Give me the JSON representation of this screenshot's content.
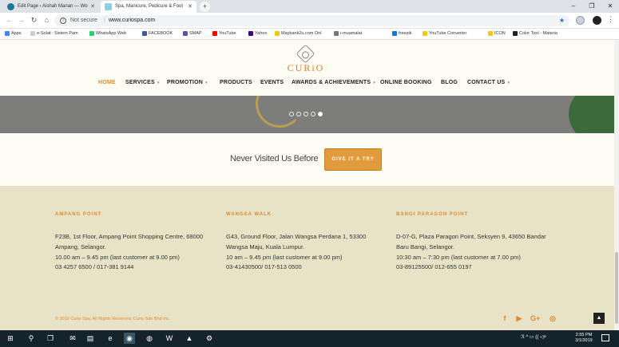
{
  "browser": {
    "tabs": [
      {
        "title": "Edit Page ‹ Aishah Manan — Wo",
        "close": "✕"
      },
      {
        "title": "Spa, Manicure, Pedicure & Foot",
        "close": "✕"
      }
    ],
    "new_tab": "+",
    "window_controls": {
      "minimize": "–",
      "maximize": "❐",
      "close": "✕"
    },
    "nav": {
      "back": "←",
      "forward": "→",
      "reload": "↻",
      "home": "⌂"
    },
    "address": {
      "security_label": "Not secure",
      "url": "www.curiospa.com",
      "star": "★"
    },
    "menu": "⋮",
    "bookmarks": [
      {
        "label": "Apps",
        "color": "#4285f4"
      },
      {
        "label": "e-Solat : Sistem Pam",
        "color": "#cccccc"
      },
      {
        "label": "WhatsApp Web",
        "color": "#25d366"
      },
      {
        "label": "FACEBOOK",
        "color": "#3b5998"
      },
      {
        "label": "SMAP",
        "color": "#6a4ea1"
      },
      {
        "label": "YouTube",
        "color": "#ff0000"
      },
      {
        "label": "Yahoo",
        "color": "#400090"
      },
      {
        "label": "Maybank2u.com Onl",
        "color": "#f5c518"
      },
      {
        "label": "i-muamalat",
        "color": "#777777"
      },
      {
        "label": "freepik",
        "color": "#1273eb"
      },
      {
        "label": "YouTube Converter",
        "color": "#f5c518"
      },
      {
        "label": "ICON",
        "color": "#f5c518"
      },
      {
        "label": "Color Tool - Materia",
        "color": "#222222"
      }
    ]
  },
  "site": {
    "logo": "CURiO",
    "nav": [
      {
        "label": "HOME",
        "caret": false,
        "active": true
      },
      {
        "label": "SERVICES",
        "caret": true,
        "active": false
      },
      {
        "label": "PROMOTION",
        "caret": true,
        "active": false
      },
      {
        "label": "PRODUCTS",
        "caret": false,
        "active": false
      },
      {
        "label": "EVENTS",
        "caret": false,
        "active": false
      },
      {
        "label": "AWARDS & ACHIEVEMENTS",
        "caret": true,
        "active": false
      },
      {
        "label": "ONLINE BOOKING",
        "caret": false,
        "active": false
      },
      {
        "label": "BLOG",
        "caret": false,
        "active": false
      },
      {
        "label": "CONTACT US",
        "caret": true,
        "active": false
      }
    ],
    "slider": {
      "dot_count": 5,
      "active_index": 4
    },
    "cta": {
      "text": "Never Visited Us Before",
      "button": "GIVE IT A TRY"
    },
    "locations": [
      {
        "name": "AMPANG POINT",
        "lines": [
          "F23B, 1st Floor, Ampang Point Shopping Centre, 68000",
          "Ampang, Selangor.",
          "10.00 am – 9.45 pm (last customer at 9.00 pm)",
          "03 4257 6500 / 017-381 9144"
        ]
      },
      {
        "name": "WANGSA WALK",
        "lines": [
          "G43, Ground Floor, Jalan Wangsa Perdana 1, 53300",
          "Wangsa Maju, Kuala Lumpur.",
          "10 am – 9.45 pm (last customer at 9.00 pm)",
          "03-41430500/ 017-513 0500"
        ]
      },
      {
        "name": "BANGI PARAGON POINT",
        "lines": [
          "D-07-G, Plaza Paragon Point, Seksyen 9, 43650 Bandar",
          "Baru Bangi, Selangor.",
          "10:30 am – 7:30 pm (last customer at 7.00 pm)",
          "03-89125500/ 012-655 0197"
        ]
      }
    ],
    "copyright": "© 2019 Curio Spa. All Rights Reserved. Curio Sdn Bhd Inc.",
    "social": {
      "facebook": "f",
      "youtube": "▶",
      "googleplus": "G+",
      "instagram": "◎"
    },
    "back_to_top": "▲",
    "accent": "#e08a2e"
  },
  "taskbar": {
    "start": "⊞",
    "search": "⚲",
    "taskview": "❐",
    "apps": [
      "✉",
      "▤",
      "e",
      "◉",
      "◍",
      "W",
      "▲",
      "⚙"
    ],
    "clock_time": "2:55 PM",
    "clock_date": "3/1/2019",
    "tray": "ℛ  ^  ▭  (( ◁×"
  }
}
